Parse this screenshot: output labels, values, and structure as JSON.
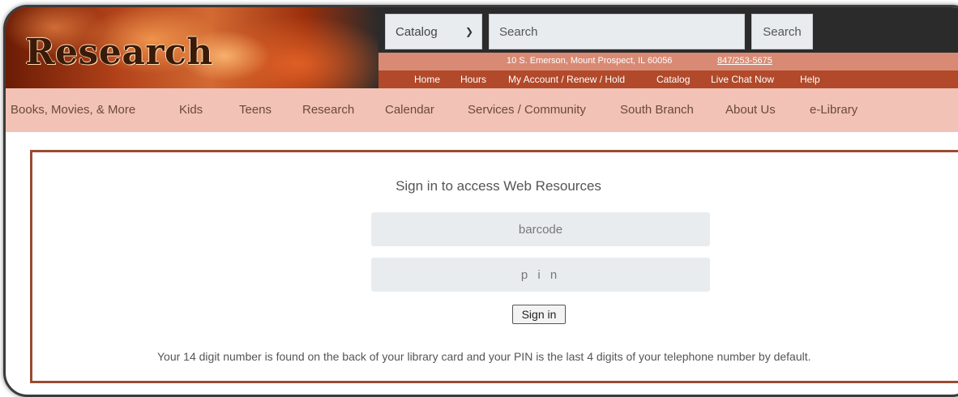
{
  "header": {
    "logo_text": "Research",
    "catalog_select": "Catalog",
    "search_placeholder": "Search",
    "search_button": "Search",
    "address": "10 S. Emerson, Mount Prospect, IL 60056",
    "phone": "847/253-5675",
    "utility_nav": [
      "Home",
      "Hours",
      "My Account / Renew / Hold",
      "Catalog",
      "Live Chat Now",
      "Help"
    ]
  },
  "main_nav": {
    "items": [
      "Books, Movies, & More",
      "Kids",
      "Teens",
      "Research",
      "Calendar",
      "Services / Community",
      "South Branch",
      "About Us",
      "e-Library"
    ]
  },
  "signin": {
    "title": "Sign in to access Web Resources",
    "barcode_placeholder": "barcode",
    "pin_placeholder": "p i n",
    "button_label": "Sign in",
    "help_text": "Your 14 digit number is found on the back of your library card and your PIN is the last 4 digits of your telephone number by default."
  },
  "colors": {
    "header_dark": "#2b2b2b",
    "address_bar": "#d98a74",
    "utility_bar": "#b1492a",
    "main_nav_bg": "#f2c2b6",
    "content_border": "#9a4a33"
  }
}
